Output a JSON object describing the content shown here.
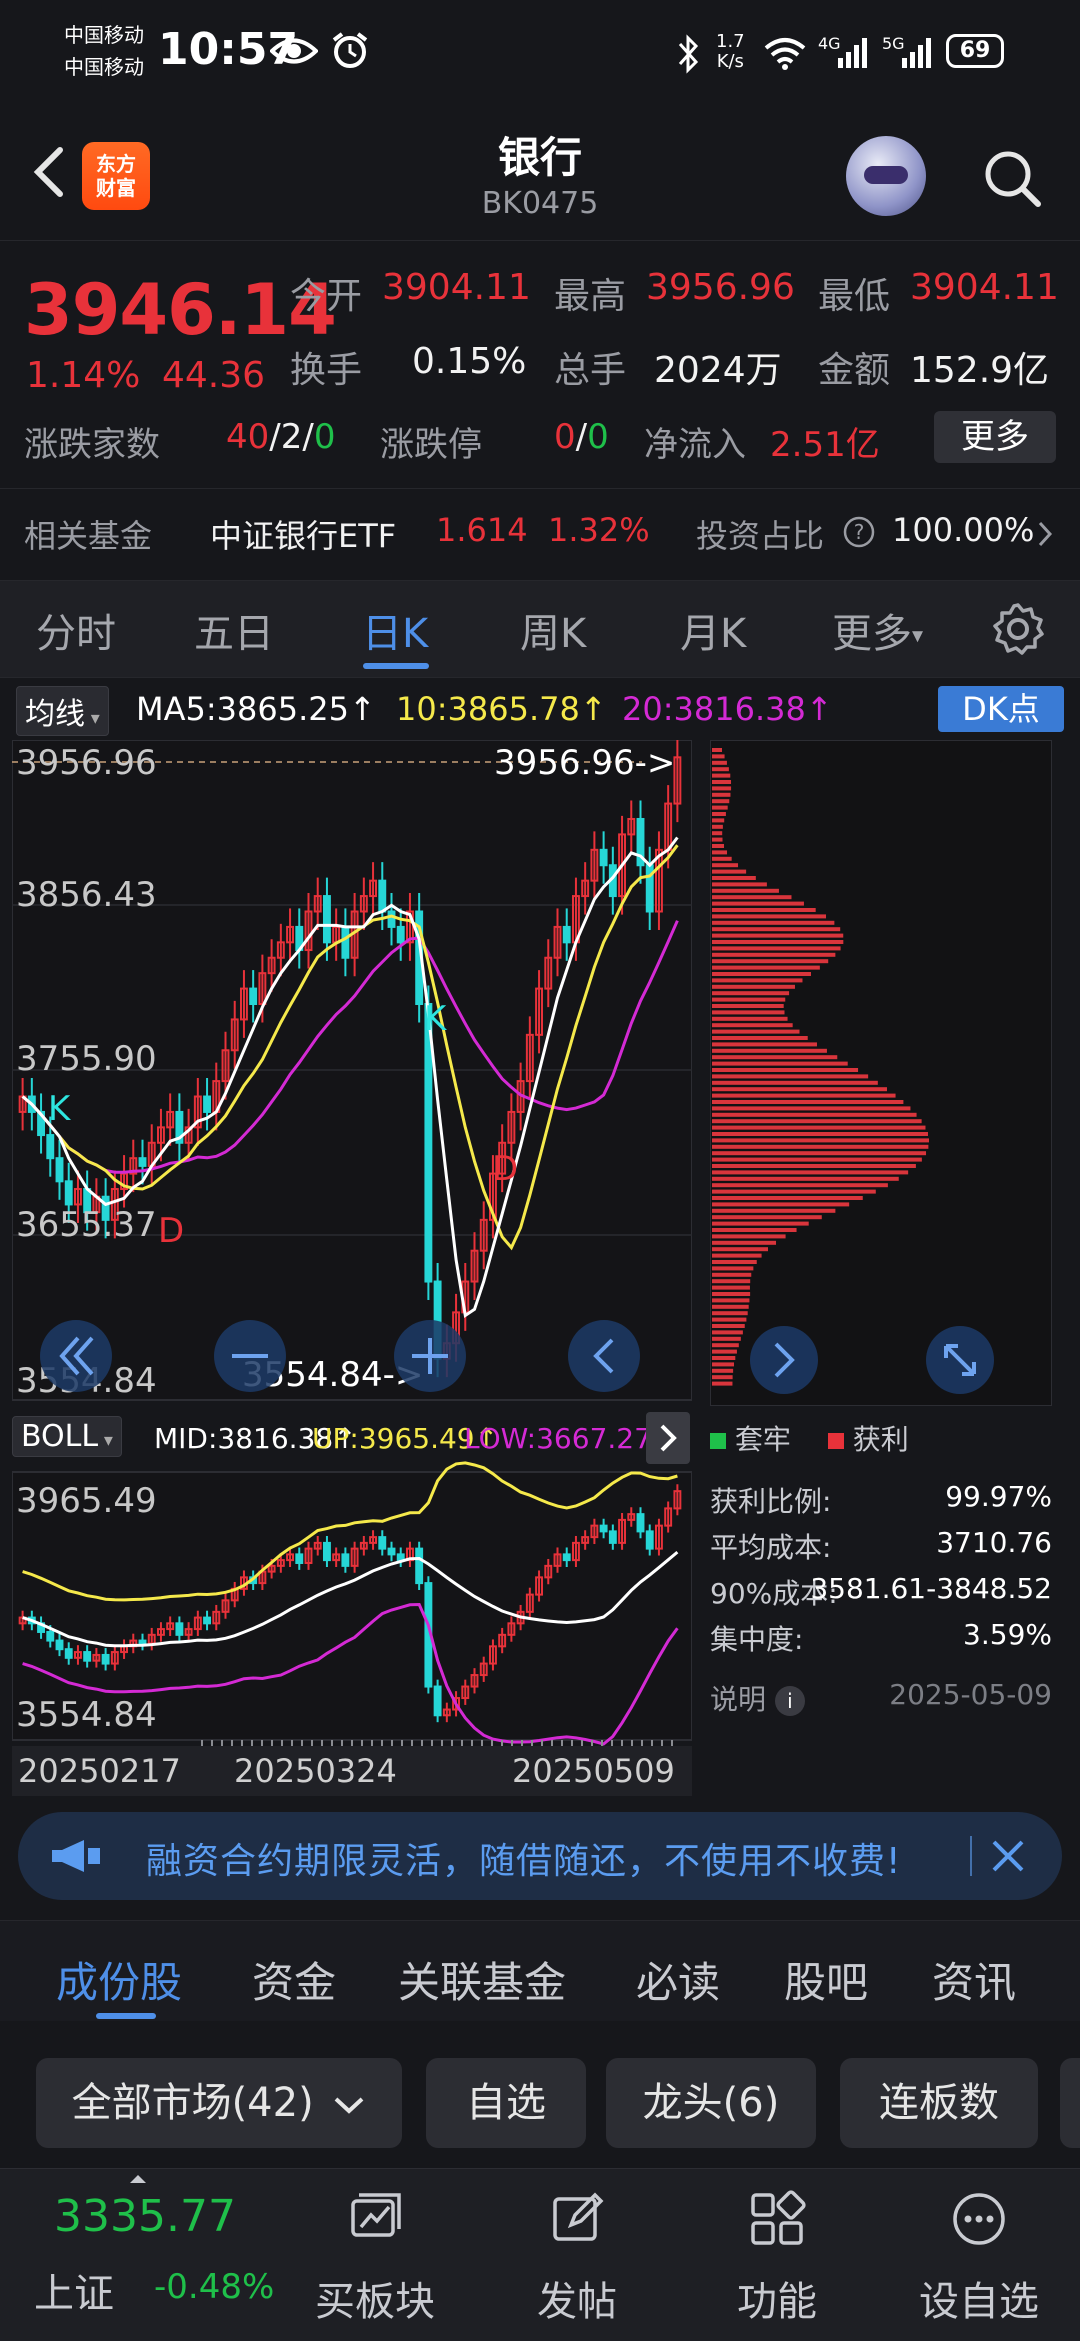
{
  "status_bar": {
    "carrier1": "中国移动",
    "carrier2": "中国移动",
    "time": "10:57",
    "net_speed_value": "1.7",
    "net_speed_unit": "K/s",
    "network1": "4G",
    "network2": "5G",
    "battery": "69"
  },
  "header": {
    "logo_line1": "东方",
    "logo_line2": "财富",
    "title": "银行",
    "code": "BK0475"
  },
  "quote": {
    "price": "3946.14",
    "change_pct": "1.14%",
    "change": "44.36",
    "open_label": "今开",
    "open": "3904.11",
    "high_label": "最高",
    "high": "3956.96",
    "low_label": "最低",
    "low": "3904.11",
    "turnover_label": "换手",
    "turnover": "0.15%",
    "volume_label": "总手",
    "volume": "2024万",
    "amount_label": "金额",
    "amount": "152.9亿",
    "updown_label": "涨跌家数",
    "up_count": "40",
    "flat_count": "2",
    "down_count": "0",
    "sep": "/",
    "limit_label": "涨跌停",
    "limit_up": "0",
    "limit_down": "0",
    "netflow_label": "净流入",
    "netflow": "2.51亿",
    "more_label": "更多"
  },
  "fund_row": {
    "label": "相关基金",
    "fund_name": "中证银行ETF",
    "fund_price": "1.614",
    "fund_pct": "1.32%",
    "ratio_label": "投资占比",
    "ratio_value": "100.00%"
  },
  "tabs": {
    "items": [
      "分时",
      "五日",
      "日K",
      "周K",
      "月K",
      "更多"
    ],
    "active": "日K"
  },
  "ma_bar": {
    "label": "均线",
    "ma5": "MA5:3865.25↑",
    "ma10": "10:3865.78↑",
    "ma20": "20:3816.38↑",
    "dk_label": "DK点"
  },
  "kline": {
    "price_labels": [
      "3956.96",
      "3856.43",
      "3755.90",
      "3655.37",
      "3554.84"
    ],
    "high_marker": "3956.96->",
    "low_marker": "3554.84->",
    "k_mark": "K",
    "d_mark": "D"
  },
  "boll_bar": {
    "label": "BOLL",
    "mid": "MID:3816.38↑",
    "up": "UP:3965.49↑",
    "low": "LOW:3667.27↑"
  },
  "boll": {
    "top_label": "3965.49",
    "bottom_label": "3554.84"
  },
  "dates": [
    "20250217",
    "20250324",
    "20250509"
  ],
  "chip": {
    "legend_trapped": "套牢",
    "legend_profit": "获利",
    "rows": [
      {
        "label": "获利比例:",
        "value": "99.97%"
      },
      {
        "label": "平均成本:",
        "value": "3710.76"
      },
      {
        "label": "90%成本:",
        "value": "3581.61-3848.52"
      },
      {
        "label": "集中度:",
        "value": "3.59%"
      }
    ],
    "note_label": "说明",
    "date": "2025-05-09"
  },
  "ad": {
    "text": "融资合约期限灵活，随借随还，不使用不收费!"
  },
  "section_tabs": {
    "items": [
      "成份股",
      "资金",
      "关联基金",
      "必读",
      "股吧",
      "资讯"
    ],
    "active": "成份股"
  },
  "filters": {
    "market": "全部市场(42)",
    "watchlist": "自选",
    "leaders": "龙头(6)",
    "streak": "连板数"
  },
  "bottom_nav": {
    "index_value": "3335.77",
    "index_name": "上证",
    "index_pct": "-0.48%",
    "items": [
      "买板块",
      "发帖",
      "功能",
      "设自选"
    ]
  },
  "colors": {
    "up": "#e8323a",
    "down": "#1fc04a",
    "accent": "#4e8fe8",
    "ma5": "#ffffff",
    "ma10": "#f5e94b",
    "ma20": "#d42ad4"
  }
}
